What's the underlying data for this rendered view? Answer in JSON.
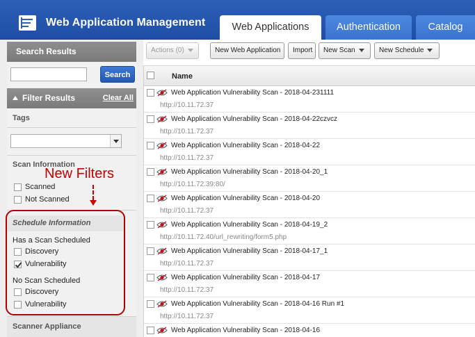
{
  "header": {
    "title": "Web Application Management",
    "tabs": [
      {
        "label": "Web Applications",
        "active": true
      },
      {
        "label": "Authentication",
        "active": false
      },
      {
        "label": "Catalog",
        "active": false
      }
    ],
    "color": "#2356b0"
  },
  "sidebar": {
    "search_results_title": "Search Results",
    "search_input_value": "",
    "search_button": "Search",
    "filter_results_title": "Filter Results",
    "clear_all": "Clear All",
    "tags_label": "Tags",
    "tags_select_value": "",
    "scan_info_label": "Scan Information",
    "scan_info_options": [
      {
        "label": "Scanned",
        "checked": false
      },
      {
        "label": "Not Scanned",
        "checked": false
      }
    ],
    "schedule_info_label": "Schedule Information",
    "has_schedule_label": "Has a Scan Scheduled",
    "has_schedule_options": [
      {
        "label": "Discovery",
        "checked": false
      },
      {
        "label": "Vulnerability",
        "checked": true
      }
    ],
    "no_schedule_label": "No Scan Scheduled",
    "no_schedule_options": [
      {
        "label": "Discovery",
        "checked": false
      },
      {
        "label": "Vulnerability",
        "checked": false
      }
    ],
    "scanner_appliance_label": "Scanner Appliance"
  },
  "annotation": {
    "callout": "New Filters",
    "color": "#c40000"
  },
  "toolbar": {
    "actions": "Actions (0)",
    "new_web_app": "New Web Application",
    "import": "Import",
    "new_scan": "New Scan",
    "new_schedule": "New Schedule"
  },
  "grid": {
    "column_name": "Name",
    "rows": [
      {
        "name": "Web Application Vulnerability Scan - 2018-04-231111",
        "url": "http://10.11.72.37"
      },
      {
        "name": "Web Application Vulnerability Scan - 2018-04-22czvcz",
        "url": "http://10.11.72.37"
      },
      {
        "name": "Web Application Vulnerability Scan - 2018-04-22",
        "url": "http://10.11.72.37"
      },
      {
        "name": "Web Application Vulnerability Scan - 2018-04-20_1",
        "url": "http://10.11.72.39:80/"
      },
      {
        "name": "Web Application Vulnerability Scan - 2018-04-20",
        "url": "http://10.11.72.37"
      },
      {
        "name": "Web Application Vulnerability Scan - 2018-04-19_2",
        "url": "http://10.11.72.40/url_rewriting/form5.php"
      },
      {
        "name": "Web Application Vulnerability Scan - 2018-04-17_1",
        "url": "http://10.11.72.37"
      },
      {
        "name": "Web Application Vulnerability Scan - 2018-04-17",
        "url": "http://10.11.72.37"
      },
      {
        "name": "Web Application Vulnerability Scan - 2018-04-16 Run #1",
        "url": "http://10.11.72.37"
      },
      {
        "name": "Web Application Vulnerability Scan - 2018-04-16",
        "url": ""
      }
    ]
  }
}
